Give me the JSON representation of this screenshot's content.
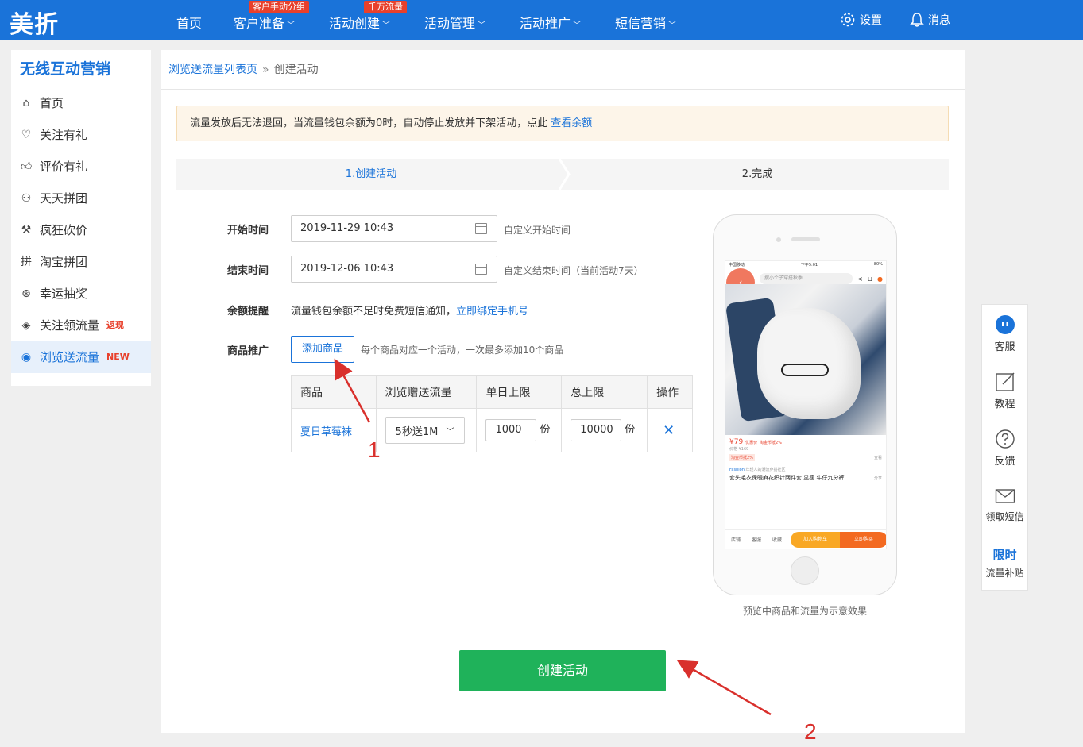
{
  "topnav": {
    "logo": "美折",
    "items": [
      {
        "label": "首页",
        "badge": ""
      },
      {
        "label": "客户准备",
        "badge": "客户手动分组"
      },
      {
        "label": "活动创建",
        "badge": "千万流量"
      },
      {
        "label": "活动管理",
        "badge": ""
      },
      {
        "label": "活动推广",
        "badge": ""
      },
      {
        "label": "短信营销",
        "badge": ""
      }
    ],
    "settings": "设置",
    "messages": "消息"
  },
  "sidebar": {
    "title": "无线互动营销",
    "items": [
      {
        "label": "首页",
        "icon": "home-icon",
        "tag": ""
      },
      {
        "label": "关注有礼",
        "icon": "heart-icon",
        "tag": ""
      },
      {
        "label": "评价有礼",
        "icon": "thumbs-up-icon",
        "tag": ""
      },
      {
        "label": "天天拼团",
        "icon": "group-icon",
        "tag": ""
      },
      {
        "label": "疯狂砍价",
        "icon": "hammer-icon",
        "tag": ""
      },
      {
        "label": "淘宝拼团",
        "icon": "pin-char-icon",
        "tag": ""
      },
      {
        "label": "幸运抽奖",
        "icon": "lottery-icon",
        "tag": ""
      },
      {
        "label": "关注领流量",
        "icon": "location-icon",
        "tag": "返现"
      },
      {
        "label": "浏览送流量",
        "icon": "eye-icon",
        "tag": "NEW"
      }
    ]
  },
  "breadcrumb": {
    "parent": "浏览送流量列表页",
    "separator": "»",
    "current": "创建活动"
  },
  "notice": {
    "text": "流量发放后无法退回，当流量钱包余额为0时，自动停止发放并下架活动，点此",
    "link": "查看余额"
  },
  "steps": {
    "step1": "1.创建活动",
    "step2": "2.完成"
  },
  "form": {
    "start_label": "开始时间",
    "start_value": "2019-11-29 10:43",
    "start_hint": "自定义开始时间",
    "end_label": "结束时间",
    "end_value": "2019-12-06 10:43",
    "end_hint": "自定义结束时间（当前活动7天）",
    "balance_label": "余额提醒",
    "balance_text": "流量钱包余额不足时免费短信通知，",
    "balance_link": "立即绑定手机号",
    "goods_label": "商品推广",
    "add_button": "添加商品",
    "add_hint": "每个商品对应一个活动，一次最多添加10个商品"
  },
  "goods_table": {
    "headers": [
      "商品",
      "浏览赠送流量",
      "单日上限",
      "总上限",
      "操作"
    ],
    "row": {
      "name": "夏日草莓袜",
      "traffic": "5秒送1M",
      "daily_limit": "1000",
      "total_limit": "10000",
      "unit": "份"
    }
  },
  "phone_preview": {
    "status_left": "中国移动",
    "status_time": "下午5:01",
    "status_battery": "80%",
    "search_placeholder": "搜小个子穿搭秋季",
    "price": "¥79",
    "price_tag": "优惠价",
    "coin_tag": "淘金币抵2%",
    "old_price": "价格 ¥169",
    "coin_badge": "淘金币抵2%",
    "view_more": "查看",
    "store_line": "年轻人的潮流穿搭社区",
    "store_brand": "Fashion",
    "title": "套头毛衣保暖麻花织针两件套 显瘦 牛仔九分裤",
    "share": "分享",
    "shop": "店铺",
    "service": "客服",
    "favorite": "收藏",
    "cart_button": "加入购物车",
    "buy_button": "立即购买",
    "caption": "预览中商品和流量为示意效果"
  },
  "create_button": "创建活动",
  "float_panel": {
    "items": [
      {
        "label": "客服",
        "icon": "customer-service-icon"
      },
      {
        "label": "教程",
        "icon": "edit-icon"
      },
      {
        "label": "反馈",
        "icon": "help-icon"
      },
      {
        "label": "领取短信",
        "icon": "mail-icon"
      },
      {
        "label": "流量补贴",
        "tag": "限时"
      }
    ]
  },
  "annotations": {
    "label1": "1",
    "label2": "2",
    "color": "#d9302c"
  },
  "colors": {
    "brand_blue": "#1a73d9",
    "create_green": "#1fb25a",
    "tag_red": "#e8402c"
  }
}
